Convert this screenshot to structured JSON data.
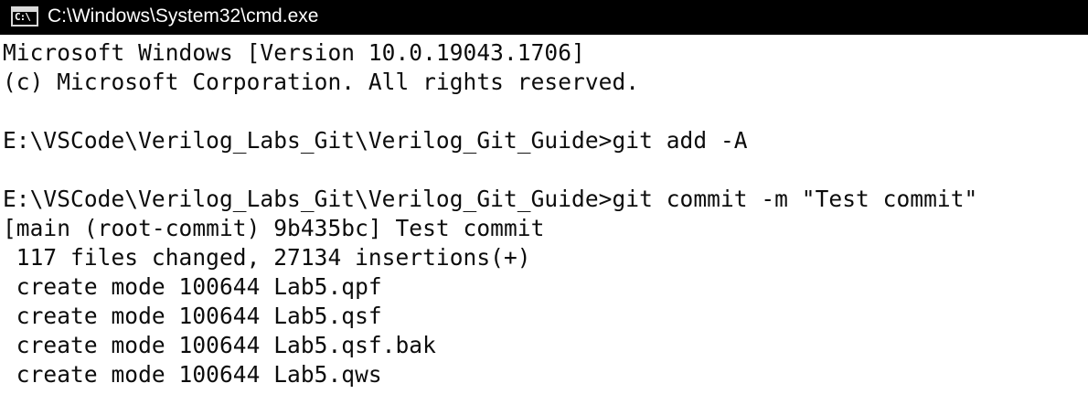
{
  "window": {
    "title": "C:\\Windows\\System32\\cmd.exe",
    "icon": "cmd-icon",
    "titlebar_color": "#000000",
    "background_color": "#ffffff",
    "text_color": "#0c0c0c"
  },
  "console": {
    "lines": [
      "Microsoft Windows [Version 10.0.19043.1706]",
      "(c) Microsoft Corporation. All rights reserved.",
      "",
      "E:\\VSCode\\Verilog_Labs_Git\\Verilog_Git_Guide>git add -A",
      "",
      "E:\\VSCode\\Verilog_Labs_Git\\Verilog_Git_Guide>git commit -m \"Test commit\"",
      "[main (root-commit) 9b435bc] Test commit",
      " 117 files changed, 27134 insertions(+)",
      " create mode 100644 Lab5.qpf",
      " create mode 100644 Lab5.qsf",
      " create mode 100644 Lab5.qsf.bak",
      " create mode 100644 Lab5.qws"
    ]
  }
}
